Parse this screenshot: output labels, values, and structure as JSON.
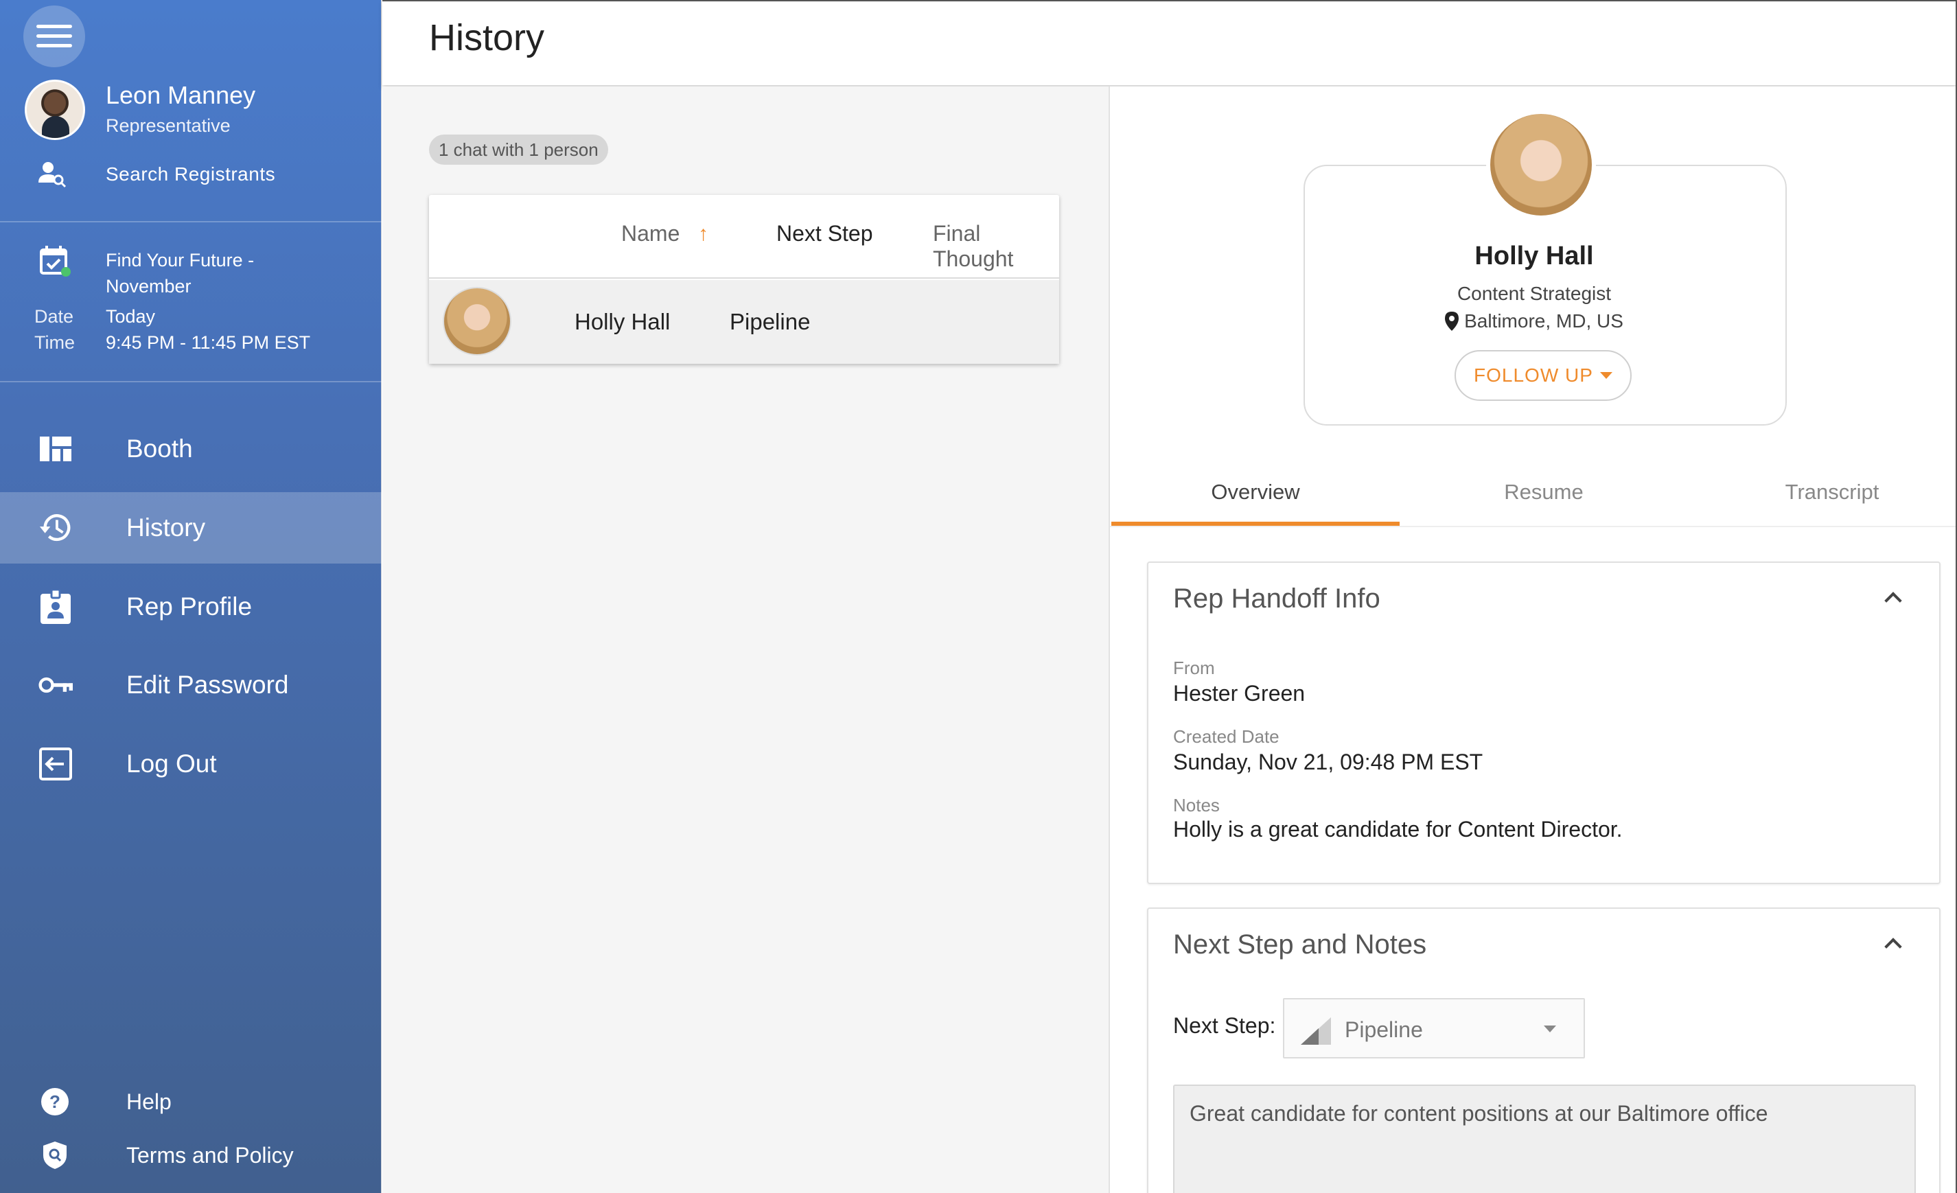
{
  "header": {
    "title": "History"
  },
  "user": {
    "name": "Leon Manney",
    "role": "Representative"
  },
  "sidebar": {
    "search_label": "Search Registrants",
    "event": {
      "title": "Find Your Future - November",
      "date_label": "Date",
      "date_value": "Today",
      "time_label": "Time",
      "time_value": "9:45 PM - 11:45 PM EST"
    },
    "nav": [
      {
        "label": "Booth",
        "icon": "booth-icon"
      },
      {
        "label": "History",
        "icon": "history-icon",
        "active": true
      },
      {
        "label": "Rep Profile",
        "icon": "badge-icon"
      },
      {
        "label": "Edit Password",
        "icon": "key-icon"
      },
      {
        "label": "Log Out",
        "icon": "logout-icon"
      }
    ],
    "footer": [
      {
        "label": "Help",
        "icon": "help-icon"
      },
      {
        "label": "Terms and Policy",
        "icon": "shield-icon"
      }
    ]
  },
  "list": {
    "summary_chip": "1 chat with 1 person",
    "columns": [
      "Name",
      "Next Step",
      "Final Thought"
    ],
    "rows": [
      {
        "name": "Holly Hall",
        "next_step": "Pipeline",
        "final_thought": ""
      }
    ]
  },
  "profile": {
    "name": "Holly Hall",
    "title": "Content Strategist",
    "location": "Baltimore, MD, US",
    "follow_up_label": "FOLLOW UP"
  },
  "tabs": [
    "Overview",
    "Resume",
    "Transcript"
  ],
  "handoff": {
    "title": "Rep Handoff Info",
    "from_label": "From",
    "from_value": "Hester Green",
    "created_label": "Created Date",
    "created_value": "Sunday, Nov 21, 09:48 PM EST",
    "notes_label": "Notes",
    "notes_value": "Holly is a great candidate for Content Director."
  },
  "next_step_panel": {
    "title": "Next Step and Notes",
    "next_step_label": "Next Step:",
    "next_step_value": "Pipeline",
    "notes_text": "Great candidate for content positions at our Baltimore office"
  },
  "colors": {
    "accent": "#ef8b2c",
    "sidebar_top": "#4a7ccc",
    "sidebar_bottom": "#41608f"
  }
}
